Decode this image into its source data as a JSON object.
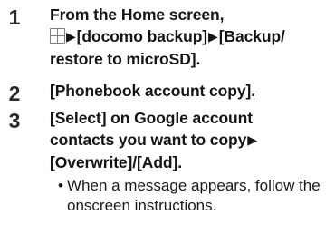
{
  "steps": [
    {
      "number": "1",
      "lines": [
        "From the Home screen,",
        "[docomo backup]",
        "[Backup/",
        "restore to microSD]."
      ]
    },
    {
      "number": "2",
      "lines": [
        "[Phonebook account copy]."
      ]
    },
    {
      "number": "3",
      "lines": [
        "[Select] on Google account",
        "contacts you want to copy",
        "[Overwrite]/[Add]."
      ],
      "note": {
        "bullet": "•",
        "lines": [
          "When a message appears, follow the",
          "onscreen instructions."
        ]
      }
    }
  ],
  "glyphs": {
    "arrow": "▶"
  },
  "icons": {
    "apps": "apps-grid-icon",
    "apps_color": "#1e9fd9"
  }
}
